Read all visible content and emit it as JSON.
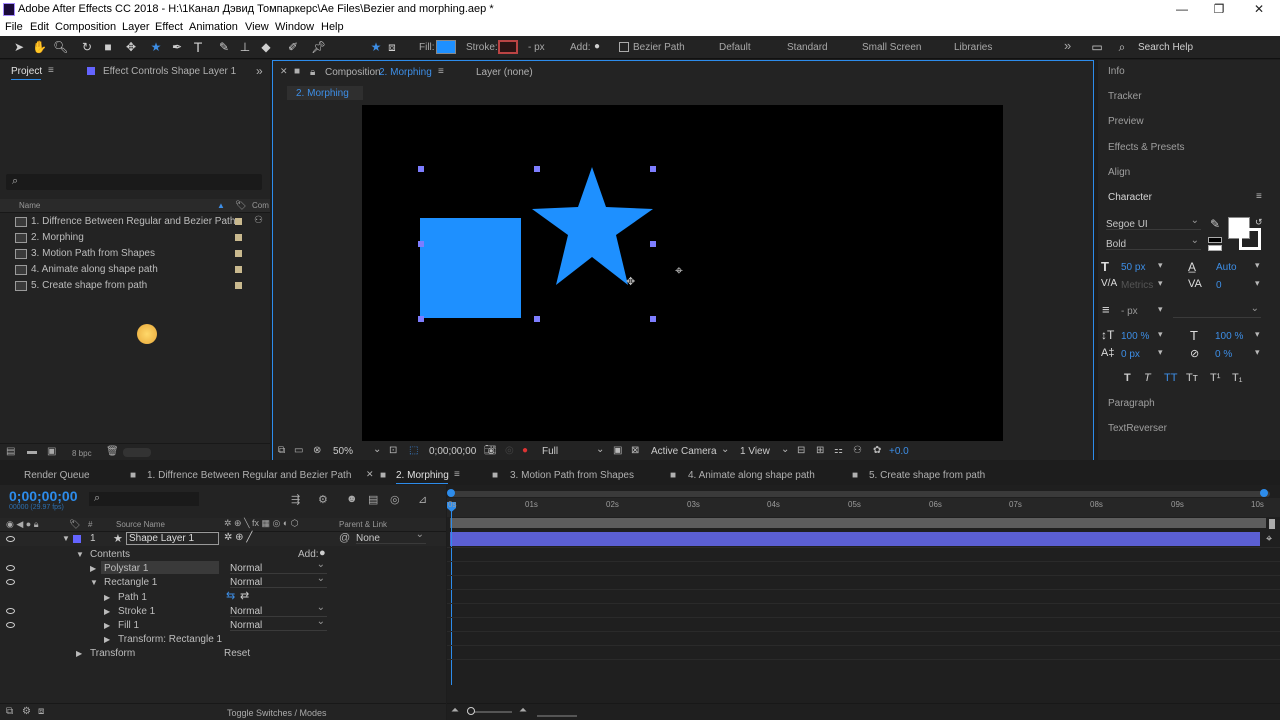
{
  "app": {
    "title": "Adobe After Effects CC 2018 - H:\\1Канал Дэвид Томпаркерс\\Ae Files\\Bezier and morphing.aep *"
  },
  "window_controls": {
    "min": "—",
    "max": "❐",
    "close": "✕"
  },
  "menu": [
    "File",
    "Edit",
    "Composition",
    "Layer",
    "Effect",
    "Animation",
    "View",
    "Window",
    "Help"
  ],
  "toolbar": {
    "fill": "Fill:",
    "stroke": "Stroke:",
    "stroke_px": "- px",
    "add": "Add:",
    "bezier": "Bezier Path",
    "workspaces": [
      "Default",
      "Standard",
      "Small Screen",
      "Libraries"
    ],
    "search": "Search Help",
    "more": "»",
    "fill_color": "#1e90ff"
  },
  "project": {
    "tab": "Project",
    "tab_menu": "≡",
    "effect_tab": "Effect Controls Shape Layer 1",
    "search_icon": "⌕",
    "col_name": "Name",
    "col_com": "Com",
    "items": [
      "1. Diffrence Between Regular and Bezier Path",
      "2. Morphing",
      "3. Motion Path from Shapes",
      "4. Animate along shape path",
      "5. Create shape from path"
    ],
    "bpc": "8 bpc"
  },
  "comp": {
    "tab": "Composition",
    "tab_active": "2. Morphing",
    "layer_tab": "Layer  (none)",
    "breadcrumb": "2. Morphing",
    "shape_color": "#1e90ff"
  },
  "viewer": {
    "zoom": "50%",
    "time": "0;00;00;00",
    "res": "Full",
    "camera": "Active Camera",
    "views": "1 View",
    "exposure": "+0.0"
  },
  "right": {
    "info": "Info",
    "tracker": "Tracker",
    "preview": "Preview",
    "effects": "Effects & Presets",
    "align": "Align",
    "character": "Character",
    "font": "Segoe UI",
    "style": "Bold",
    "size": "50 px",
    "leading": "Auto",
    "kerning": "Metrics",
    "tracking": "0",
    "stroke_w": "- px",
    "vscale": "100 %",
    "hscale": "100 %",
    "baseline": "0 px",
    "tsume": "0 %",
    "paragraph": "Paragraph",
    "textreverser": "TextReverser",
    "type_buttons": [
      "T",
      "T",
      "TT",
      "Tт",
      "T¹",
      "T₁"
    ]
  },
  "timeline": {
    "render_queue": "Render Queue",
    "tabs": [
      "1. Diffrence Between Regular and Bezier Path",
      "2. Morphing",
      "3. Motion Path from Shapes",
      "4. Animate along shape path",
      "5. Create shape from path"
    ],
    "timecode": "0;00;00;00",
    "fps": "00000 (29.97 fps)",
    "col_source": "Source Name",
    "col_parent": "Parent & Link",
    "col_num": "#",
    "layer_num": "1",
    "layer_name": "Shape Layer 1",
    "parent": "None",
    "contents": "Contents",
    "add": "Add:",
    "props": [
      {
        "name": "Polystar 1",
        "mode": "Normal"
      },
      {
        "name": "Rectangle 1",
        "mode": "Normal"
      },
      {
        "name": "Path 1",
        "mode": ""
      },
      {
        "name": "Stroke 1",
        "mode": "Normal"
      },
      {
        "name": "Fill 1",
        "mode": "Normal"
      },
      {
        "name": "Transform: Rectangle 1",
        "mode": ""
      }
    ],
    "transform": "Transform",
    "reset": "Reset",
    "toggle": "Toggle Switches / Modes",
    "ticks": [
      "0s",
      "01s",
      "02s",
      "03s",
      "04s",
      "05s",
      "06s",
      "07s",
      "08s",
      "09s",
      "10s"
    ]
  }
}
